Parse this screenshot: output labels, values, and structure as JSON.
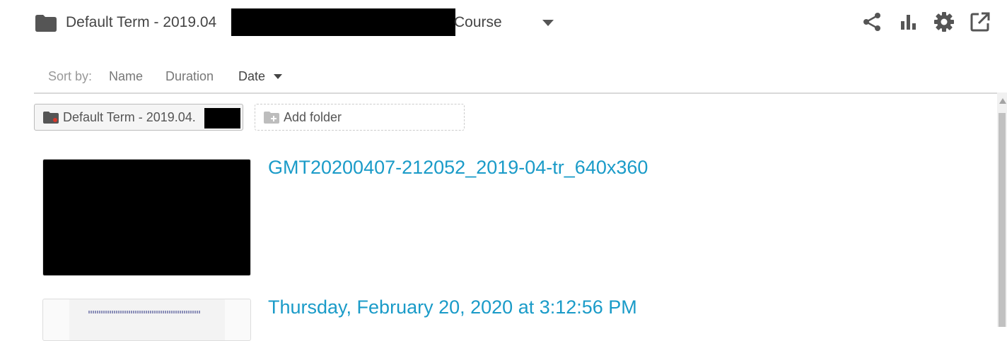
{
  "header": {
    "title_prefix": "Default Term - 2019.04",
    "title_suffix": "Course",
    "icons": [
      "share-icon",
      "stats-icon",
      "settings-icon",
      "open-external-icon"
    ]
  },
  "sort": {
    "label": "Sort by:",
    "options": [
      {
        "label": "Name"
      },
      {
        "label": "Duration"
      },
      {
        "label": "Date"
      }
    ],
    "active": "Date"
  },
  "folders": {
    "current": "Default Term - 2019.04.",
    "add_label": "Add folder"
  },
  "sessions": [
    {
      "title": "GMT20200407-212052_2019-04-tr_640x360"
    },
    {
      "title": "Thursday, February 20, 2020 at 3:12:56 PM"
    }
  ],
  "colors": {
    "link": "#1a9bc8",
    "text": "#444444",
    "muted": "#999999"
  }
}
